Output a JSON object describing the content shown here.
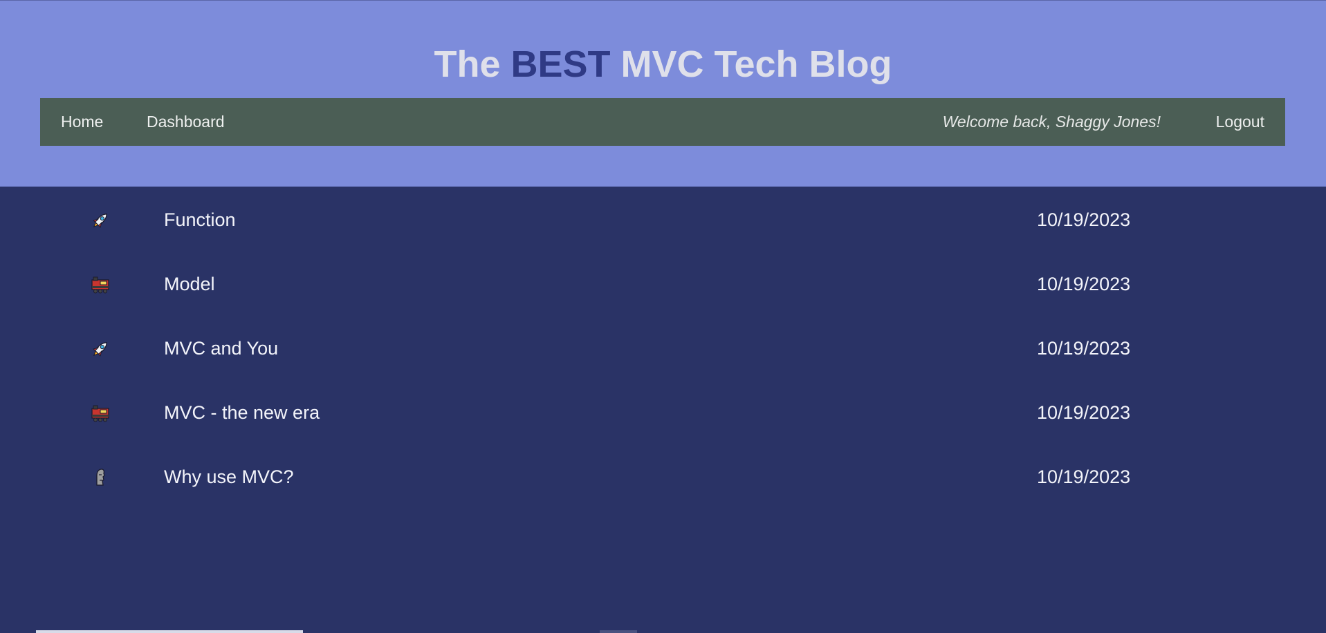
{
  "header": {
    "title_prefix": "The ",
    "title_accent": "BEST",
    "title_suffix": " MVC Tech Blog",
    "colors": {
      "header_bg": "#7d8cdb",
      "title": "#dfe0ea",
      "accent": "#2f3a85",
      "nav_bg": "#4b5e55",
      "page_bg": "#2a3366"
    }
  },
  "nav": {
    "home": "Home",
    "dashboard": "Dashboard",
    "welcome": "Welcome back, Shaggy Jones!",
    "logout": "Logout"
  },
  "posts": [
    {
      "icon": "rocket-icon",
      "title": "Function",
      "date": "10/19/2023"
    },
    {
      "icon": "locomotive-icon",
      "title": "Model",
      "date": "10/19/2023"
    },
    {
      "icon": "rocket-icon",
      "title": "MVC and You",
      "date": "10/19/2023"
    },
    {
      "icon": "locomotive-icon",
      "title": "MVC - the new era",
      "date": "10/19/2023"
    },
    {
      "icon": "moai-icon",
      "title": "Why use MVC?",
      "date": "10/19/2023"
    }
  ]
}
